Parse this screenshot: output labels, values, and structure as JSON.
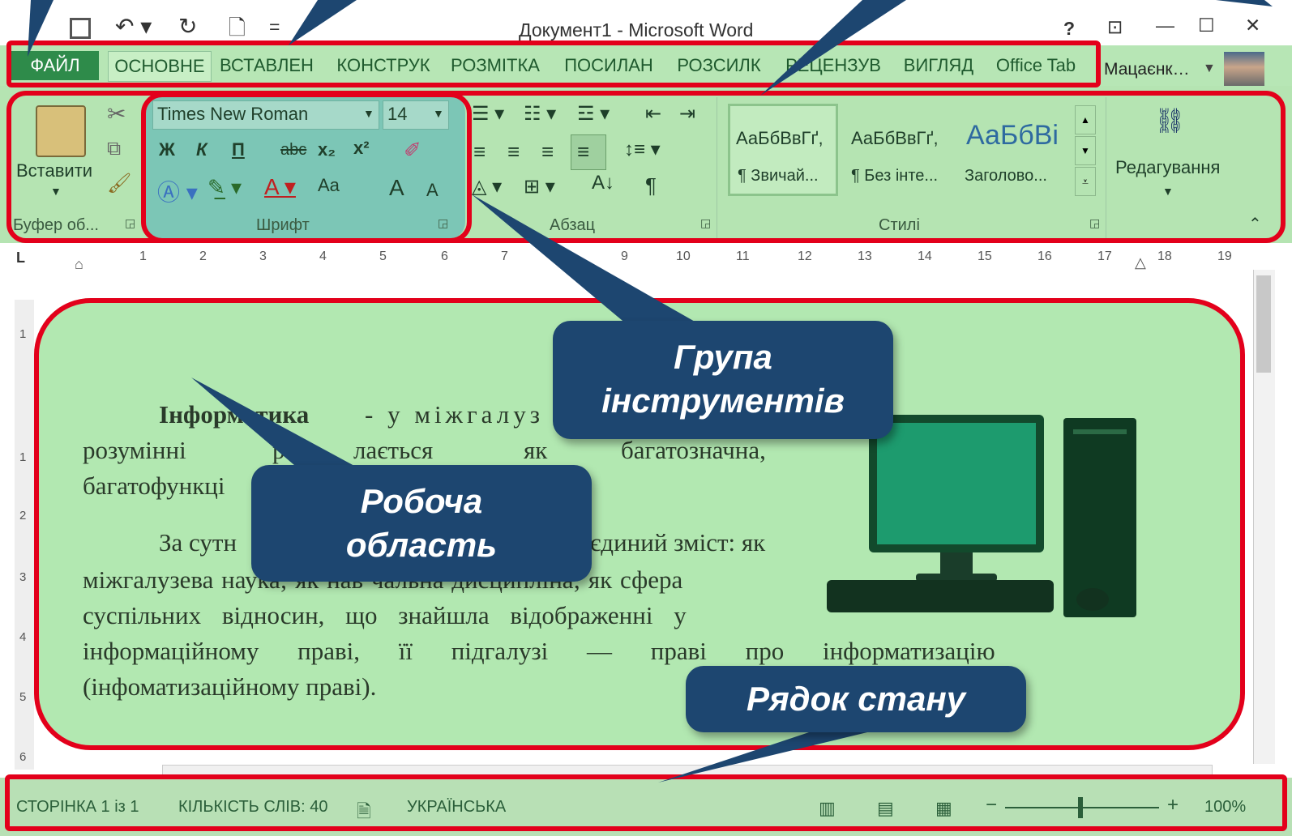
{
  "window": {
    "title": "Документ1 - Microsoft Word",
    "help": "?",
    "user_name": "Мацаєнк…"
  },
  "tabs": [
    "ФАЙЛ",
    "ОСНОВНЕ",
    "ВСТАВЛЕН",
    "КОНСТРУК",
    "РОЗМІТКА",
    "ПОСИЛАН",
    "РОЗСИЛК",
    "РЕЦЕНЗУВ",
    "ВИГЛЯД",
    "Office Tab"
  ],
  "ribbon": {
    "paste_label": "Вставити",
    "clipboard_group": "Буфер об...",
    "font_name": "Times New Roman",
    "font_size": "14",
    "font_group": "Шрифт",
    "bold": "Ж",
    "italic": "К",
    "underline": "П",
    "strike": "abc",
    "subscript": "x₂",
    "superscript": "x²",
    "case": "Aa",
    "grow": "A",
    "shrink": "A",
    "paragraph_group": "Абзац",
    "styles_group": "Стилі",
    "style_samples": [
      "АаБбВвГґ,",
      "АаБбВвГґ,",
      "АаБбВі"
    ],
    "style_names": [
      "¶ Звичай...",
      "¶ Без інте...",
      "Заголово..."
    ],
    "editing_label": "Редагування"
  },
  "ruler_ticks": [
    "1",
    "2",
    "3",
    "4",
    "5",
    "6",
    "7",
    "9",
    "10",
    "11",
    "12",
    "13",
    "14",
    "15",
    "16",
    "17",
    "18",
    "19"
  ],
  "vruler_ticks": [
    "1",
    "1",
    "2",
    "3",
    "4",
    "5",
    "6"
  ],
  "document": {
    "bold_word": "Інформатика",
    "line1_rest": "- у міжгалуз",
    "line2a": "розумінні",
    "line2b": "ре",
    "line2c": "лається",
    "line2d": "як",
    "line2e": "багатозначна,",
    "line3": "багатофункці",
    "line4a": "За сутн",
    "line4b": "єдиний зміст: як",
    "line5": "міжгалузева наука; як нав чальна дисципліна; як сфера",
    "line6": "суспільних відносин, що знайшла відображенні у",
    "line7": "інформаційному праві, її підгалузі — праві про інформатизацію",
    "line8": "(інфоматизаційному праві)."
  },
  "status": {
    "page": "СТОРІНКА 1 із 1",
    "words": "КІЛЬКІСТЬ СЛІВ: 40",
    "lang": "УКРАЇНСЬКА",
    "zoom": "100%"
  },
  "callouts": {
    "toolgroup_line1": "Група",
    "toolgroup_line2": "інструментів",
    "work_line1": "Робоча",
    "work_line2": "область",
    "status": "Рядок стану"
  },
  "colors": {
    "highlight_red": "#e3001b",
    "callout_blue": "#1d4670",
    "ribbon_green": "#b5e4b2"
  }
}
